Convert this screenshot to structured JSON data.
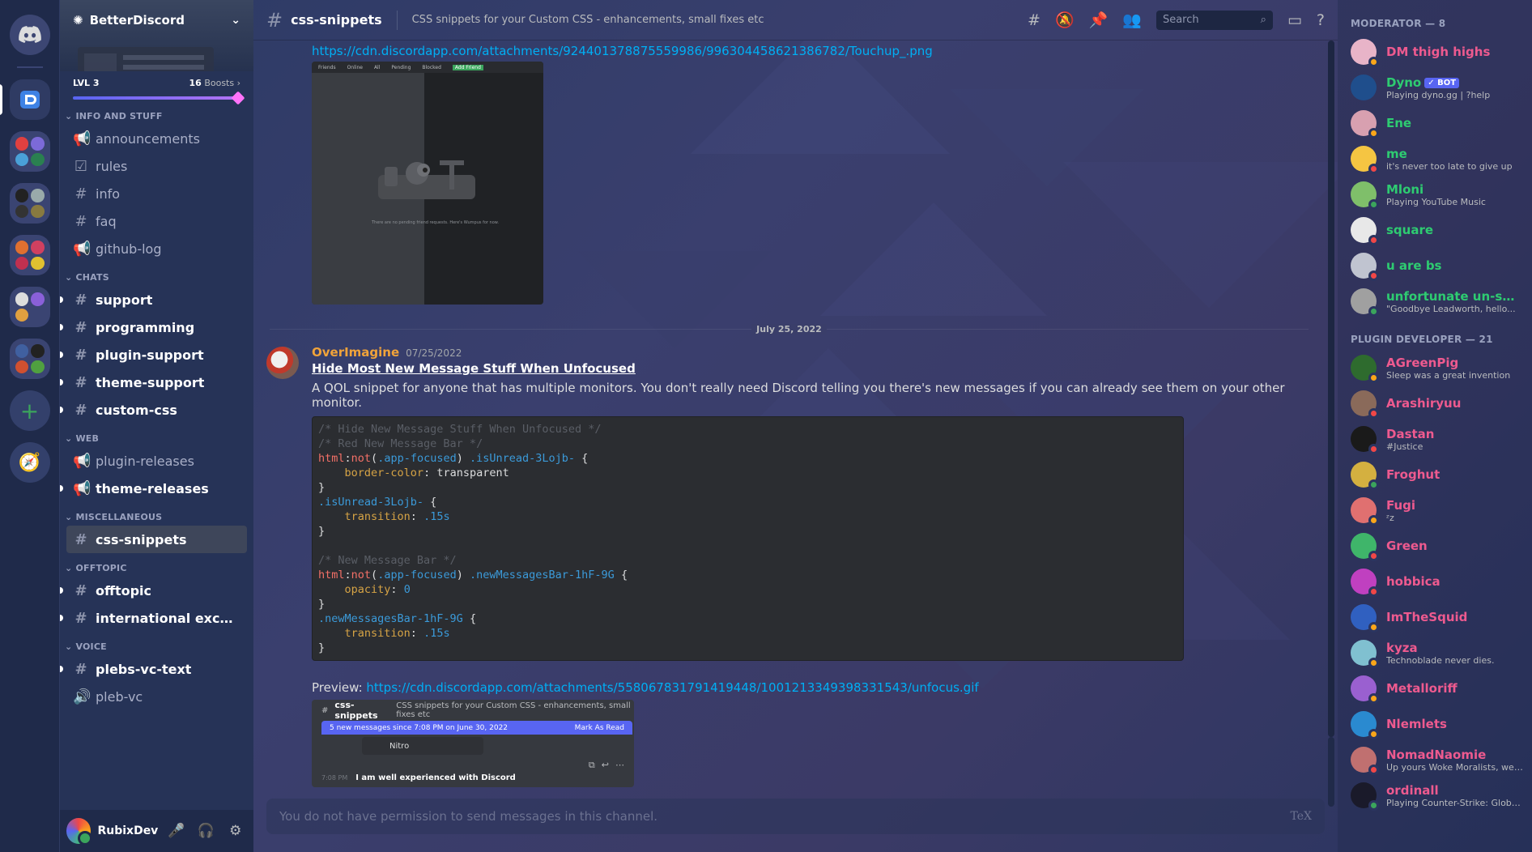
{
  "server": {
    "name": "BetterDiscord",
    "level": "LVL 3",
    "boosts_count": "16",
    "boosts_label": "Boosts",
    "boost_progress": 1.0
  },
  "categories": [
    {
      "name": "INFO AND STUFF",
      "channels": [
        {
          "name": "announcements",
          "icon": "megaphone-icon",
          "unread": false
        },
        {
          "name": "rules",
          "icon": "checkbox-icon",
          "unread": false
        },
        {
          "name": "info",
          "icon": "hash-icon",
          "unread": false
        },
        {
          "name": "faq",
          "icon": "hash-icon",
          "unread": false
        },
        {
          "name": "github-log",
          "icon": "megaphone-icon",
          "unread": false
        }
      ]
    },
    {
      "name": "CHATS",
      "channels": [
        {
          "name": "support",
          "icon": "hash-icon",
          "unread": true
        },
        {
          "name": "programming",
          "icon": "hash-icon",
          "unread": true
        },
        {
          "name": "plugin-support",
          "icon": "hash-icon",
          "unread": true
        },
        {
          "name": "theme-support",
          "icon": "hash-icon",
          "unread": true
        },
        {
          "name": "custom-css",
          "icon": "hash-icon",
          "unread": true
        }
      ]
    },
    {
      "name": "WEB",
      "channels": [
        {
          "name": "plugin-releases",
          "icon": "megaphone-icon",
          "unread": false
        },
        {
          "name": "theme-releases",
          "icon": "megaphone-icon",
          "unread": true
        }
      ]
    },
    {
      "name": "MISCELLANEOUS",
      "channels": [
        {
          "name": "css-snippets",
          "icon": "hash-icon",
          "unread": false,
          "active": true
        }
      ]
    },
    {
      "name": "OFFTOPIC",
      "channels": [
        {
          "name": "offtopic",
          "icon": "hash-icon",
          "unread": true
        },
        {
          "name": "international except ...",
          "icon": "hash-icon",
          "unread": true
        }
      ]
    },
    {
      "name": "VOICE",
      "channels": [
        {
          "name": "plebs-vc-text",
          "icon": "hash-icon",
          "unread": true
        },
        {
          "name": "pleb-vc",
          "icon": "speaker-icon",
          "unread": false
        }
      ]
    }
  ],
  "user": {
    "name": "RubixDev"
  },
  "header": {
    "channel": "css-snippets",
    "topic": "CSS snippets for your Custom CSS - enhancements, small fixes etc",
    "search_placeholder": "Search"
  },
  "messages": {
    "top_url": "https://cdn.discordapp.com/attachments/924401378875559986/996304458621386782/Touchup_.png",
    "top_image": {
      "tabs": [
        "Friends",
        "Online",
        "All",
        "Pending",
        "Blocked"
      ],
      "add_friend": "Add Friend",
      "caption": "There are no pending friend requests. Here's Wumpus for now."
    },
    "date_divider": "July 25, 2022",
    "author": "OverImagine",
    "timestamp": "07/25/2022",
    "subject": "Hide Most New Message Stuff When Unfocused",
    "body": "A QOL snippet for anyone that has multiple monitors. You don't really need Discord telling you there's new messages if you can already see them on your other monitor.",
    "code_lines": [
      [
        {
          "t": "/* Hide New Message Stuff When Unfocused */",
          "c": "c-com"
        }
      ],
      [
        {
          "t": "/* Red New Message Bar */",
          "c": "c-com"
        }
      ],
      [
        {
          "t": "html",
          "c": "c-tag"
        },
        {
          "t": ":",
          "c": ""
        },
        {
          "t": "not",
          "c": "c-kw"
        },
        {
          "t": "(",
          "c": ""
        },
        {
          "t": ".app-focused",
          "c": "c-cls"
        },
        {
          "t": ") ",
          "c": ""
        },
        {
          "t": ".isUnread-3Lojb-",
          "c": "c-cls"
        },
        {
          "t": " {",
          "c": ""
        }
      ],
      [
        {
          "t": "    ",
          "c": ""
        },
        {
          "t": "border-color",
          "c": "c-prop"
        },
        {
          "t": ": transparent",
          "c": ""
        }
      ],
      [
        {
          "t": "}",
          "c": ""
        }
      ],
      [
        {
          "t": ".isUnread-3Lojb-",
          "c": "c-cls"
        },
        {
          "t": " {",
          "c": ""
        }
      ],
      [
        {
          "t": "    ",
          "c": ""
        },
        {
          "t": "transition",
          "c": "c-prop"
        },
        {
          "t": ": ",
          "c": ""
        },
        {
          "t": ".15s",
          "c": "c-num"
        }
      ],
      [
        {
          "t": "}",
          "c": ""
        }
      ],
      [
        {
          "t": "",
          "c": ""
        }
      ],
      [
        {
          "t": "/* New Message Bar */",
          "c": "c-com"
        }
      ],
      [
        {
          "t": "html",
          "c": "c-tag"
        },
        {
          "t": ":",
          "c": ""
        },
        {
          "t": "not",
          "c": "c-kw"
        },
        {
          "t": "(",
          "c": ""
        },
        {
          "t": ".app-focused",
          "c": "c-cls"
        },
        {
          "t": ") ",
          "c": ""
        },
        {
          "t": ".newMessagesBar-1hF-9G",
          "c": "c-cls"
        },
        {
          "t": " {",
          "c": ""
        }
      ],
      [
        {
          "t": "    ",
          "c": ""
        },
        {
          "t": "opacity",
          "c": "c-prop"
        },
        {
          "t": ": ",
          "c": ""
        },
        {
          "t": "0",
          "c": "c-num"
        }
      ],
      [
        {
          "t": "}",
          "c": ""
        }
      ],
      [
        {
          "t": ".newMessagesBar-1hF-9G",
          "c": "c-cls"
        },
        {
          "t": " {",
          "c": ""
        }
      ],
      [
        {
          "t": "    ",
          "c": ""
        },
        {
          "t": "transition",
          "c": "c-prop"
        },
        {
          "t": ": ",
          "c": ""
        },
        {
          "t": ".15s",
          "c": "c-num"
        }
      ],
      [
        {
          "t": "}",
          "c": ""
        }
      ]
    ],
    "preview_label": "Preview:",
    "preview_url": "https://cdn.discordapp.com/attachments/558067831791419448/1001213349398331543/unfocus.gif",
    "gif": {
      "channel": "css-snippets",
      "topic": "CSS snippets for your Custom CSS - enhancements, small fixes etc",
      "bar_text": "5 new messages since 7:08 PM on June 30, 2022",
      "bar_action": "Mark As Read",
      "nitro": "Nitro",
      "msg_time": "7:08 PM",
      "msg_text": "I am well experienced with Discord"
    }
  },
  "composer": {
    "placeholder": "You do not have permission to send messages in this channel.",
    "tex": "TeX"
  },
  "member_groups": [
    {
      "title": "MODERATOR — 8",
      "members": [
        {
          "name": "DM thigh highs",
          "activity": "",
          "color": "#ee5a8f",
          "status": "#faa61a",
          "avatar": "#e8b4c8"
        },
        {
          "name": "Dyno",
          "bot": "✓ BOT",
          "activity": "Playing dyno.gg | ?help",
          "color": "#2ecc71",
          "status": "",
          "avatar": "#1f4e8c"
        },
        {
          "name": "Ene",
          "activity": "",
          "color": "#2ecc71",
          "status": "#faa61a",
          "avatar": "#d8a0b0"
        },
        {
          "name": "me",
          "activity": "it's never too late to give up",
          "color": "#2ecc71",
          "status": "#f04747",
          "avatar": "#f5c542"
        },
        {
          "name": "Mloni",
          "activity": "Playing YouTube Music",
          "color": "#2ecc71",
          "status": "#3ba55c",
          "avatar": "#7fbf6a"
        },
        {
          "name": "square",
          "activity": "",
          "color": "#2ecc71",
          "status": "#f04747",
          "avatar": "#e8e8e8"
        },
        {
          "name": "u are bs",
          "activity": "",
          "color": "#2ecc71",
          "status": "#f04747",
          "avatar": "#c0c4d0"
        },
        {
          "name": "unfortunate un-str...",
          "activity": "\"Goodbye Leadworth, hello...",
          "color": "#2ecc71",
          "status": "#3ba55c",
          "avatar": "#a0a0a0"
        }
      ]
    },
    {
      "title": "PLUGIN DEVELOPER — 21",
      "members": [
        {
          "name": "AGreenPig",
          "activity": "Sleep was a great invention",
          "color": "#ee5a8f",
          "status": "#faa61a",
          "avatar": "#2e6b2e"
        },
        {
          "name": "Arashiryuu",
          "activity": "",
          "color": "#ee5a8f",
          "status": "#f04747",
          "avatar": "#8a6a5a"
        },
        {
          "name": "Dastan",
          "activity": "#Justice",
          "color": "#ee5a8f",
          "status": "#f04747",
          "avatar": "#1a1a1a"
        },
        {
          "name": "Froghut",
          "activity": "",
          "color": "#ee5a8f",
          "status": "#3ba55c",
          "avatar": "#d4b040"
        },
        {
          "name": "Fugi",
          "activity": "ᶻz",
          "color": "#ee5a8f",
          "status": "#faa61a",
          "avatar": "#e07070"
        },
        {
          "name": "Green",
          "activity": "",
          "color": "#ee5a8f",
          "status": "#f04747",
          "avatar": "#3fb56a"
        },
        {
          "name": "hobbica",
          "activity": "",
          "color": "#ee5a8f",
          "status": "#f04747",
          "avatar": "#c040c0"
        },
        {
          "name": "ImTheSquid",
          "activity": "",
          "color": "#ee5a8f",
          "status": "#faa61a",
          "avatar": "#3060c0"
        },
        {
          "name": "kyza",
          "activity": "Technoblade never dies.",
          "color": "#ee5a8f",
          "status": "#faa61a",
          "avatar": "#80c0d0"
        },
        {
          "name": "Metalloriff",
          "activity": "",
          "color": "#ee5a8f",
          "status": "#faa61a",
          "avatar": "#9a60d0"
        },
        {
          "name": "Nlemlets",
          "activity": "",
          "color": "#ee5a8f",
          "status": "#faa61a",
          "avatar": "#2a8ad0"
        },
        {
          "name": "NomadNaomie",
          "activity": "Up yours Woke Moralists, we'l...",
          "color": "#ee5a8f",
          "status": "#f04747",
          "avatar": "#c07070"
        },
        {
          "name": "ordinall",
          "activity": "Playing Counter-Strike: Global ...",
          "color": "#ee5a8f",
          "status": "#3ba55c",
          "avatar": "#1a1a2a"
        }
      ]
    }
  ],
  "colors": {
    "accent": "#5865f2",
    "link": "#00aff4",
    "author": "#f0a33a"
  }
}
